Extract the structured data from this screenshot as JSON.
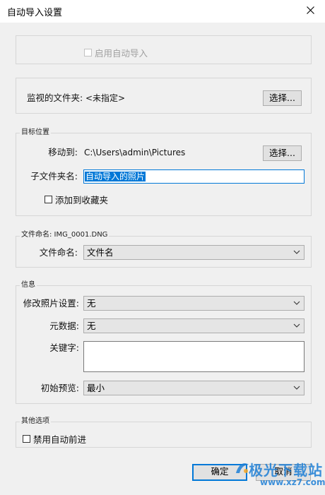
{
  "window": {
    "title": "自动导入设置"
  },
  "auto_import": {
    "label": "启用自动导入",
    "checked": false,
    "disabled": true
  },
  "watch": {
    "label": "监视的文件夹:",
    "value": "<未指定>",
    "choose_label": "选择..."
  },
  "destination": {
    "section_title": "目标位置",
    "move_to_label": "移动到:",
    "move_to_value": "C:\\Users\\admin\\Pictures",
    "choose_label": "选择...",
    "subfolder_label": "子文件夹名:",
    "subfolder_value": "自动导入的照片",
    "add_to_collection_label": "添加到收藏夹",
    "add_to_collection_checked": false
  },
  "file_naming": {
    "section_title": "文件命名: IMG_0001.DNG",
    "label": "文件命名:",
    "selected": "文件名"
  },
  "info": {
    "section_title": "信息",
    "develop_label": "修改照片设置:",
    "develop_selected": "无",
    "metadata_label": "元数据:",
    "metadata_selected": "无",
    "keywords_label": "关键字:",
    "keywords_value": "",
    "preview_label": "初始预览:",
    "preview_selected": "最小"
  },
  "other": {
    "section_title": "其他选项",
    "disable_label": "禁用自动前进",
    "disable_checked": false
  },
  "buttons": {
    "ok": "确定",
    "cancel": "取消"
  },
  "watermark": {
    "title": "极光下载站",
    "url": "www.xz7.com"
  },
  "colors": {
    "accent": "#0078d7",
    "watermark": "#1d7fd6"
  }
}
